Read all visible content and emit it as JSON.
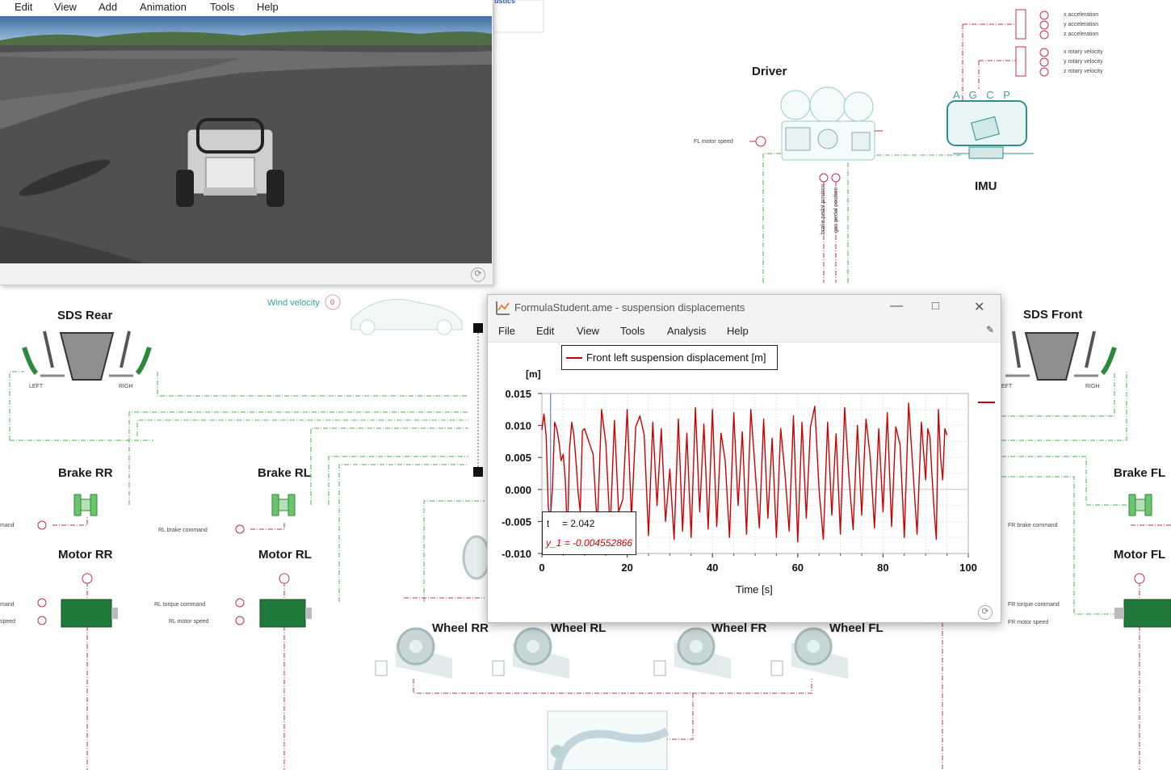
{
  "viewer": {
    "menu": [
      "Edit",
      "View",
      "Add",
      "Animation",
      "Tools",
      "Help"
    ]
  },
  "sketch": {
    "blocks": {
      "driver": "Driver",
      "imu": "IMU",
      "sds_rear": "SDS Rear",
      "sds_front": "SDS Front",
      "brake_rr": "Brake RR",
      "brake_rl": "Brake RL",
      "brake_fl": "Brake FL",
      "motor_rr": "Motor RR",
      "motor_rl": "Motor RL",
      "motor_fl": "Motor FL",
      "wheel_rr": "Wheel RR",
      "wheel_rl": "Wheel RL",
      "wheel_fr": "Wheel FR",
      "wheel_fl": "Wheel FL"
    },
    "port_labels": {
      "fl_motor_speed": "FL motor speed",
      "brake_pedal": "brake pedal position",
      "gas_pedal": "gas pedal position",
      "x_acc": "x acceleration",
      "y_acc": "y acceleration",
      "z_acc": "z acceleration",
      "x_rot": "x rotary velocity",
      "y_rot": "y rotary velocity",
      "z_rot": "z rotary velocity",
      "wind_velocity": "Wind velocity",
      "wind_value": "0",
      "rl_brake_command": "RL brake command",
      "rl_torque_command": "RL torque command",
      "rl_motor_speed": "RL motor speed",
      "fr_brake_command": "FR brake command",
      "fr_torque_command": "FR torque command",
      "fr_motor_speed": "FR motor speed",
      "mand_1": "mand",
      "mand_2": "mand",
      "speed": "speed",
      "left_rear": "LEFT",
      "right_rear": "RIGH",
      "left_front": "EFT",
      "right_front": "RIGH",
      "imu_ports": "A G C P",
      "partial_header": "ustics"
    }
  },
  "plot_window": {
    "title": "FormulaStudent.ame - suspension displacements",
    "menu": [
      "File",
      "Edit",
      "View",
      "Tools",
      "Analysis",
      "Help"
    ],
    "cursor": {
      "t_label": "t",
      "t_value": "= 2.042",
      "y_label": "y_1 = -0.004552866"
    }
  },
  "colors": {
    "series": "#cc0000",
    "sketch_red": "#c0304a",
    "sketch_green": "#2a8a3a",
    "sketch_teal": "#3c9f9f",
    "motor_green": "#1f7a3c"
  },
  "chart_data": {
    "type": "line",
    "title": "",
    "xlabel": "Time [s]",
    "ylabel": "[m]",
    "xlim": [
      0,
      100
    ],
    "ylim": [
      -0.01,
      0.015
    ],
    "x_ticks": [
      "0",
      "20",
      "40",
      "60",
      "80",
      "100"
    ],
    "y_ticks": [
      "0.015",
      "0.010",
      "0.005",
      "0.000",
      "-0.005",
      "-0.010"
    ],
    "grid": true,
    "legend_position": "top-left",
    "series": [
      {
        "name": "Front left suspension displacement [m]",
        "color": "#cc0000",
        "x": [
          0,
          0.5,
          1,
          1.5,
          2,
          2.5,
          3,
          3.5,
          4,
          4.5,
          5,
          5.5,
          6,
          6.5,
          7,
          7.5,
          8,
          8.5,
          9,
          9.5,
          10,
          11,
          12,
          13,
          14,
          15,
          16,
          17,
          18,
          19,
          20,
          21,
          22,
          23,
          24,
          25,
          26,
          27,
          28,
          29,
          30,
          31,
          32,
          33,
          34,
          35,
          36,
          37,
          38,
          39,
          40,
          41,
          42,
          43,
          44,
          45,
          46,
          47,
          48,
          49,
          50,
          51,
          52,
          53,
          54,
          55,
          56,
          57,
          58,
          59,
          60,
          61,
          62,
          63,
          64,
          65,
          66,
          67,
          68,
          69,
          70,
          71,
          72,
          73,
          74,
          75,
          76,
          77,
          78,
          79,
          80,
          81,
          82,
          83,
          84,
          85,
          86,
          87,
          88,
          89,
          90,
          90.5,
          91,
          91.5,
          92,
          92.5,
          93,
          93.5,
          94,
          94.5,
          95
        ],
        "values": [
          0.0093,
          0.0118,
          0.0083,
          -0.0028,
          -0.0045,
          0.0005,
          0.0105,
          0.0095,
          0.0075,
          0.0045,
          0.0055,
          0.0015,
          -0.0075,
          0.0065,
          0.0105,
          0.0085,
          0.0045,
          -0.0005,
          -0.0035,
          0.0092,
          0.0095,
          0.0075,
          0.0055,
          -0.006,
          0.0125,
          0.0072,
          -0.0065,
          0.0108,
          -0.0035,
          -0.0015,
          0.0125,
          -0.0045,
          0.0098,
          0.0115,
          0.0085,
          -0.0072,
          0.0105,
          -0.0025,
          0.0095,
          -0.005,
          0.0032,
          -0.0078,
          0.011,
          -0.0065,
          0.0088,
          -0.0075,
          0.0128,
          -0.0035,
          0.0102,
          -0.0062,
          0.0125,
          -0.0058,
          0.0088,
          0.0045,
          -0.0075,
          0.012,
          -0.0025,
          0.009,
          -0.007,
          0.0125,
          0.0032,
          -0.006,
          0.011,
          -0.0045,
          0.008,
          -0.0075,
          0.0095,
          0.0025,
          -0.0065,
          0.0115,
          -0.0082,
          0.0105,
          -0.0045,
          0.0098,
          0.013,
          0.0,
          -0.0078,
          0.0105,
          -0.004,
          0.0087,
          -0.007,
          0.0128,
          0.002,
          -0.0063,
          0.01,
          -0.004,
          0.011,
          0.005,
          -0.006,
          0.0095,
          -0.0035,
          0.012,
          -0.0058,
          0.0098,
          0.007,
          -0.0075,
          0.0135,
          0.0032,
          -0.007,
          0.0105,
          0.0015,
          0.0095,
          0.0082,
          0.002,
          -0.0035,
          -0.0078,
          0.0125,
          0.005,
          0.0015,
          0.0095,
          0.0085
        ]
      }
    ]
  }
}
